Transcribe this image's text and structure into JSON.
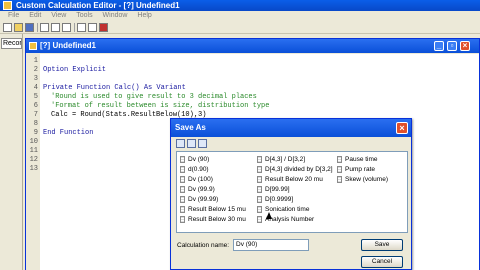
{
  "app": {
    "title": "Custom Calculation Editor - [?] Undefined1",
    "menu": [
      "File",
      "Edit",
      "View",
      "Tools",
      "Window",
      "Help"
    ],
    "left_tab": "Recor"
  },
  "editor": {
    "title": "[?] Undefined1",
    "line_numbers": [
      "1",
      "2",
      "3",
      "4",
      "5",
      "6",
      "7",
      "8",
      "9",
      "10",
      "11",
      "12",
      "13"
    ],
    "code": {
      "l2": "Option Explicit",
      "l4": "Private Function Calc() As Variant",
      "l5": "'Round is used to give result to 3 decimal places",
      "l6": "'Format of result between is size, distribution type",
      "l7": "Calc = Round(Stats.ResultBelow(10),3)",
      "l9": "End Function"
    }
  },
  "dialog": {
    "title": "Save As",
    "items_col1": [
      "Dv (90)",
      "d(0.90)",
      "Dv (100)",
      "Dv (99.9)",
      "Dv (99.99)",
      "Result Below 15 mu",
      "Result Below 30 mu"
    ],
    "items_col2": [
      "D[4,3] / D[3,2]",
      "D[4,3] divided by D[3,2]",
      "Result Below 20 mu",
      "D[99.99]",
      "D[0.9999]",
      "Sonication time",
      "Analysis Number"
    ],
    "items_col3": [
      "Pause time",
      "Pump rate",
      "Skew (volume)"
    ],
    "name_label": "Calculation name:",
    "name_value": "Dv (90)",
    "save_label": "Save",
    "cancel_label": "Cancel"
  },
  "colors": {
    "titlebar": "#0a5ee8",
    "comment": "#2a8a2a",
    "keyword": "#1a1aa0"
  }
}
